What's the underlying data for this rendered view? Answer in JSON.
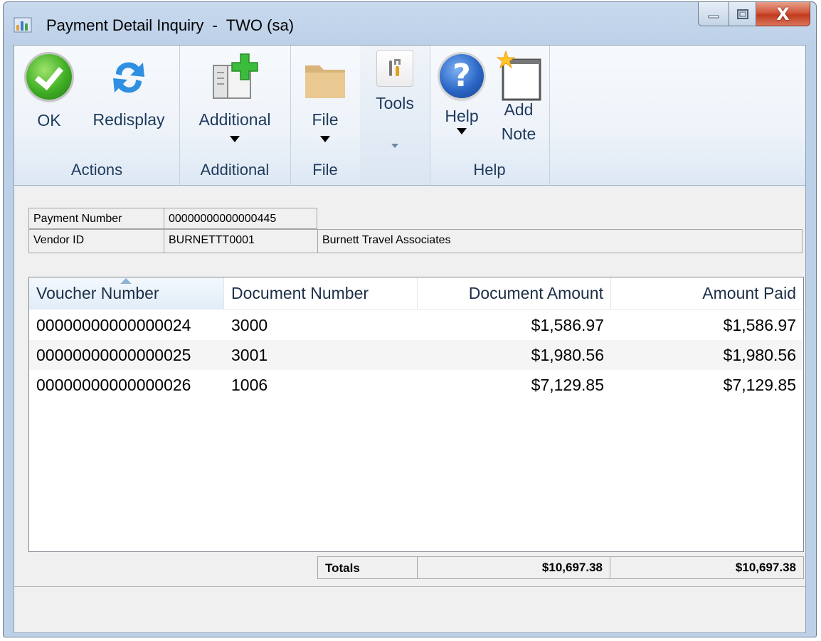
{
  "window": {
    "title": "Payment Detail Inquiry  -  TWO (sa)",
    "close_glyph": "X"
  },
  "ribbon": {
    "groups": [
      {
        "label": "Actions",
        "buttons": [
          {
            "label": "OK",
            "icon": "ok-checkmark-icon"
          },
          {
            "label": "Redisplay",
            "icon": "redisplay-arrows-icon"
          }
        ]
      },
      {
        "label": "Additional",
        "buttons": [
          {
            "label": "Additional",
            "icon": "additional-window-icon"
          }
        ]
      },
      {
        "label": "File",
        "buttons": [
          {
            "label": "File",
            "icon": "folder-icon"
          }
        ]
      },
      {
        "label": "",
        "buttons": [
          {
            "label": "Tools",
            "icon": "tools-icon"
          }
        ]
      },
      {
        "label": "Help",
        "buttons": [
          {
            "label": "Help",
            "icon": "help-question-icon"
          },
          {
            "label_line1": "Add",
            "label_line2": "Note",
            "icon": "add-note-icon"
          }
        ]
      }
    ]
  },
  "header": {
    "payment_number_label": "Payment Number",
    "payment_number": "00000000000000445",
    "vendor_id_label": "Vendor ID",
    "vendor_id": "BURNETTT0001",
    "vendor_name": "Burnett Travel Associates"
  },
  "grid": {
    "columns": [
      "Voucher Number",
      "Document Number",
      "Document Amount",
      "Amount Paid"
    ],
    "rows": [
      [
        "00000000000000024",
        "3000",
        "$1,586.97",
        "$1,586.97"
      ],
      [
        "00000000000000025",
        "3001",
        "$1,980.56",
        "$1,980.56"
      ],
      [
        "00000000000000026",
        "1006",
        "$7,129.85",
        "$7,129.85"
      ]
    ]
  },
  "totals": {
    "label": "Totals",
    "document_amount": "$10,697.38",
    "amount_paid": "$10,697.38"
  },
  "colors": {
    "ribbon_text": "#1e3a5c",
    "ok_green": "#3fae24",
    "help_blue": "#2a67c6",
    "close_red": "#c23a1e"
  }
}
